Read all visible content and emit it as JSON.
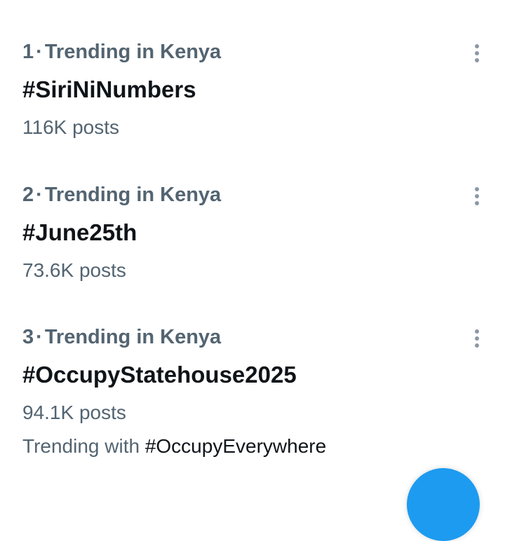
{
  "trends": [
    {
      "rank": "1",
      "separator": "·",
      "context": "Trending in Kenya",
      "name": "#SiriNiNumbers",
      "posts": "116K posts"
    },
    {
      "rank": "2",
      "separator": "·",
      "context": "Trending in Kenya",
      "name": "#June25th",
      "posts": "73.6K posts"
    },
    {
      "rank": "3",
      "separator": "·",
      "context": "Trending in Kenya",
      "name": "#OccupyStatehouse2025",
      "posts": "94.1K posts",
      "trending_with_label": "Trending with ",
      "trending_with_tag": "#OccupyEverywhere"
    }
  ],
  "icons": {
    "more": "more-vertical-icon"
  },
  "colors": {
    "primary_text": "#0f1419",
    "secondary_text": "#536471",
    "icon_gray": "#8b98a5",
    "accent_blue": "#1d9bf0"
  }
}
